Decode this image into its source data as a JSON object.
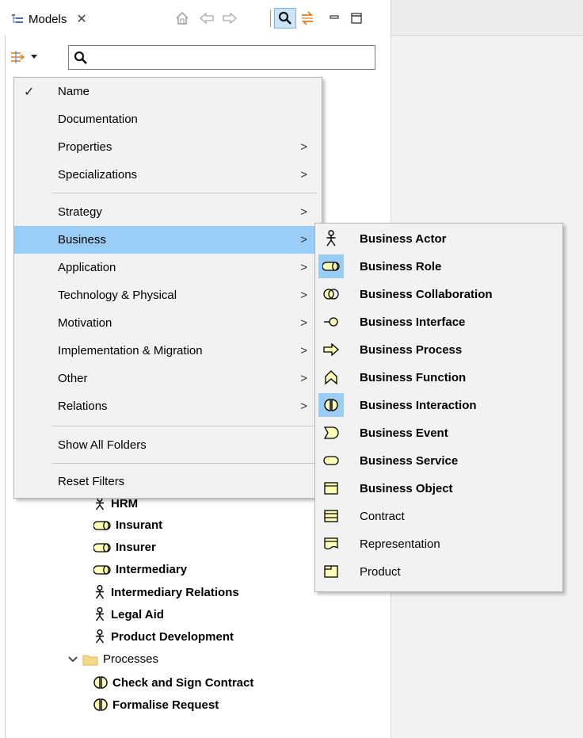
{
  "panel": {
    "tab_label": "Models",
    "close_glyph": "✕",
    "search": {
      "value": "",
      "placeholder": ""
    },
    "toolbar_icons": [
      "home-icon",
      "back-arrow-icon",
      "forward-arrow-icon",
      "search-icon",
      "link-editor-icon",
      "minimize-icon",
      "maximize-icon"
    ]
  },
  "filter_menu": {
    "items": [
      {
        "label": "Name",
        "checked": true
      },
      {
        "label": "Documentation"
      },
      {
        "label": "Properties",
        "submenu": true
      },
      {
        "label": "Specializations",
        "submenu": true
      },
      {
        "label": "Strategy",
        "submenu": true
      },
      {
        "label": "Business",
        "submenu": true,
        "selected": true
      },
      {
        "label": "Application",
        "submenu": true
      },
      {
        "label": "Technology & Physical",
        "submenu": true
      },
      {
        "label": "Motivation",
        "submenu": true
      },
      {
        "label": "Implementation & Migration",
        "submenu": true
      },
      {
        "label": "Other",
        "submenu": true
      },
      {
        "label": "Relations",
        "submenu": true
      },
      {
        "label": "Show All Folders"
      },
      {
        "label": "Reset Filters"
      }
    ],
    "submenu_arrow": ">",
    "check_glyph": "✓"
  },
  "business_submenu": {
    "items": [
      {
        "label": "Business Actor",
        "icon": "business-actor-icon",
        "bold": true
      },
      {
        "label": "Business Role",
        "icon": "business-role-icon",
        "bold": true,
        "icon_highlighted": true
      },
      {
        "label": "Business Collaboration",
        "icon": "business-collaboration-icon",
        "bold": true
      },
      {
        "label": "Business Interface",
        "icon": "business-interface-icon",
        "bold": true
      },
      {
        "label": "Business Process",
        "icon": "business-process-icon",
        "bold": true
      },
      {
        "label": "Business Function",
        "icon": "business-function-icon",
        "bold": true
      },
      {
        "label": "Business Interaction",
        "icon": "business-interaction-icon",
        "bold": true,
        "icon_highlighted": true
      },
      {
        "label": "Business Event",
        "icon": "business-event-icon",
        "bold": true
      },
      {
        "label": "Business Service",
        "icon": "business-service-icon",
        "bold": true
      },
      {
        "label": "Business Object",
        "icon": "business-object-icon",
        "bold": true
      },
      {
        "label": "Contract",
        "icon": "contract-icon",
        "bold": false
      },
      {
        "label": "Representation",
        "icon": "representation-icon",
        "bold": false
      },
      {
        "label": "Product",
        "icon": "product-icon",
        "bold": false
      }
    ]
  },
  "tree": {
    "actors": [
      {
        "label": "HRM",
        "icon": "business-actor-icon"
      },
      {
        "label": "Insurant",
        "icon": "business-role-icon"
      },
      {
        "label": "Insurer",
        "icon": "business-role-icon"
      },
      {
        "label": "Intermediary",
        "icon": "business-role-icon"
      },
      {
        "label": "Intermediary Relations",
        "icon": "business-actor-icon"
      },
      {
        "label": "Legal Aid",
        "icon": "business-actor-icon"
      },
      {
        "label": "Product Development",
        "icon": "business-actor-icon"
      }
    ],
    "folder": {
      "label": "Processes",
      "expanded": true
    },
    "processes": [
      {
        "label": "Check and  Sign Contract",
        "icon": "business-interaction-icon"
      },
      {
        "label": "Formalise Request",
        "icon": "business-interaction-icon"
      }
    ]
  },
  "colors": {
    "selection": "#99cdf5",
    "menu_bg": "#f2f2f2",
    "business_yellow": "#ffffb5",
    "folder_yellow": "#f7d985"
  }
}
